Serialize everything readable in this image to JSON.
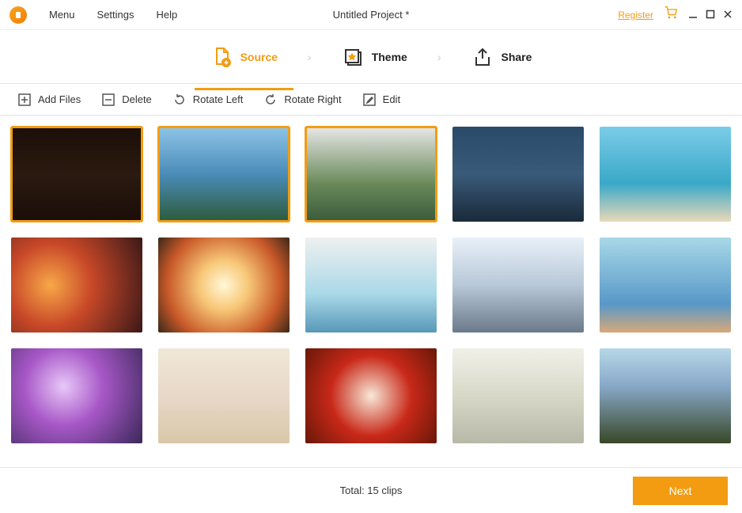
{
  "titlebar": {
    "menu": "Menu",
    "settings": "Settings",
    "help": "Help",
    "title": "Untitled Project *",
    "register": "Register"
  },
  "steps": {
    "source": "Source",
    "theme": "Theme",
    "share": "Share",
    "active": "source"
  },
  "toolbar": {
    "add_files": "Add Files",
    "delete": "Delete",
    "rotate_left": "Rotate Left",
    "rotate_right": "Rotate Right",
    "edit": "Edit"
  },
  "grid": {
    "thumbs": [
      {
        "name": "wedding-dark-barn",
        "selected": true
      },
      {
        "name": "couple-by-lake",
        "selected": true
      },
      {
        "name": "couple-walking-road",
        "selected": true
      },
      {
        "name": "couple-silhouette-sunset",
        "selected": false
      },
      {
        "name": "girl-beach-sunglasses",
        "selected": false
      },
      {
        "name": "couple-laptop-lights",
        "selected": false
      },
      {
        "name": "couple-sunset-embrace",
        "selected": false
      },
      {
        "name": "woman-pool-resort",
        "selected": false
      },
      {
        "name": "group-winter-photo",
        "selected": false
      },
      {
        "name": "baby-splashing-water",
        "selected": false
      },
      {
        "name": "woman-camera-bokeh",
        "selected": false
      },
      {
        "name": "hands-forever-tiles",
        "selected": false
      },
      {
        "name": "santa-heart-hands",
        "selected": false
      },
      {
        "name": "keychain-eggs-flatlay",
        "selected": false
      },
      {
        "name": "father-kids-field",
        "selected": false
      }
    ]
  },
  "footer": {
    "total": "Total: 15 clips",
    "next": "Next"
  },
  "colors": {
    "accent": "#f39c12"
  },
  "icons": {
    "logo": "app-logo-icon",
    "cart": "cart-icon",
    "minimize": "minimize-icon",
    "maximize": "maximize-icon",
    "close": "close-icon",
    "source": "document-plus-icon",
    "theme": "stack-star-icon",
    "share": "share-arrow-icon",
    "chevron": "chevron-right-icon",
    "add": "plus-box-icon",
    "delete": "minus-box-icon",
    "rotate_left": "rotate-left-icon",
    "rotate_right": "rotate-right-icon",
    "edit": "edit-pencil-icon"
  }
}
